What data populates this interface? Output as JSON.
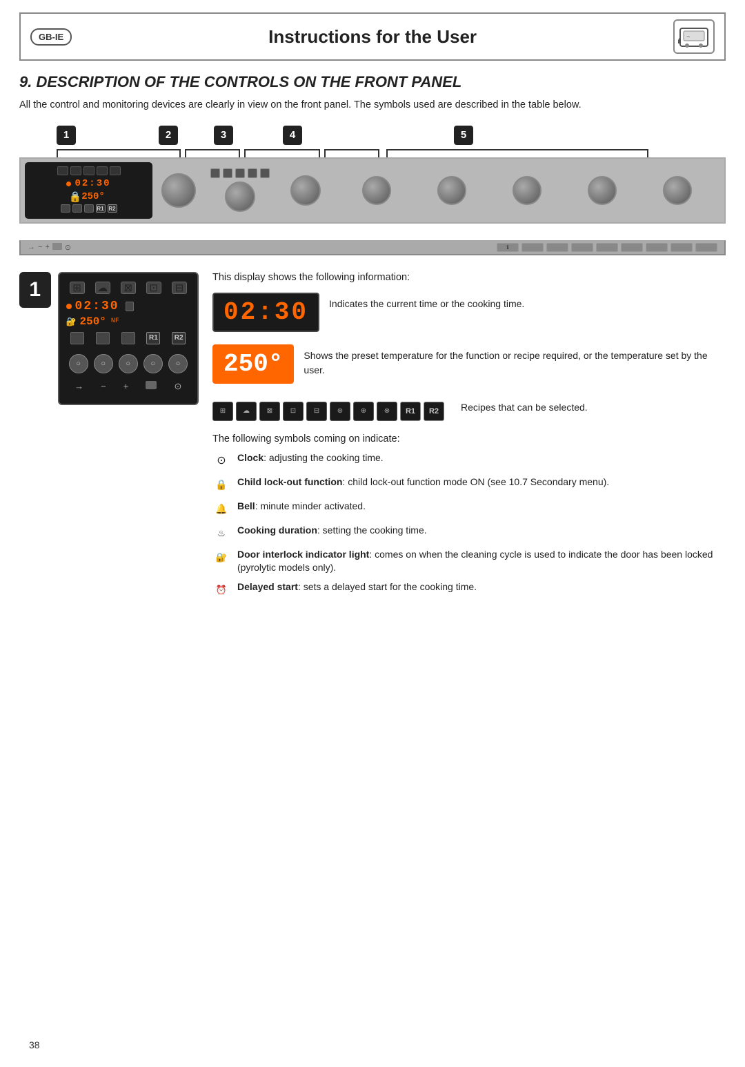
{
  "header": {
    "badge": "GB-IE",
    "title": "Instructions for the User",
    "icon_alt": "oven icon"
  },
  "section": {
    "number": "9.",
    "title": "DESCRIPTION OF THE CONTROLS ON THE FRONT PANEL",
    "intro": "All the control and monitoring devices are clearly in view on the front panel. The symbols used are described in the table below.",
    "panel_labels": [
      "1",
      "2",
      "3",
      "4",
      "5"
    ],
    "display_info_header": "This display shows the following information:",
    "time_display": "02:30",
    "temp_display": "250°",
    "time_desc": "Indicates the current time or the cooking time.",
    "temp_desc": "Shows the preset temperature for the function or recipe required, or the temperature set by the user.",
    "recipes_label": "Recipes that can be selected.",
    "following_text": "The following symbols coming on indicate:",
    "symbols": [
      {
        "icon": "⊙",
        "bold_label": "Clock",
        "text": ": adjusting the cooking time."
      },
      {
        "icon": "🔒",
        "bold_label": "Child lock-out function",
        "text": ": child lock-out function mode ON (see 10.7 Secondary menu)."
      },
      {
        "icon": "🔔",
        "bold_label": "Bell",
        "text": ": minute minder activated."
      },
      {
        "icon": "♨",
        "bold_label": "Cooking duration",
        "text": ": setting the cooking time."
      },
      {
        "icon": "🔐",
        "bold_label": "Door interlock indicator light",
        "text": ": comes on when the cleaning cycle is used to indicate the door has been locked (pyrolytic models only)."
      },
      {
        "icon": "⏰",
        "bold_label": "Delayed start",
        "text": ": sets a delayed start for the cooking time."
      }
    ],
    "section_number_badge": "1"
  },
  "page_number": "38"
}
